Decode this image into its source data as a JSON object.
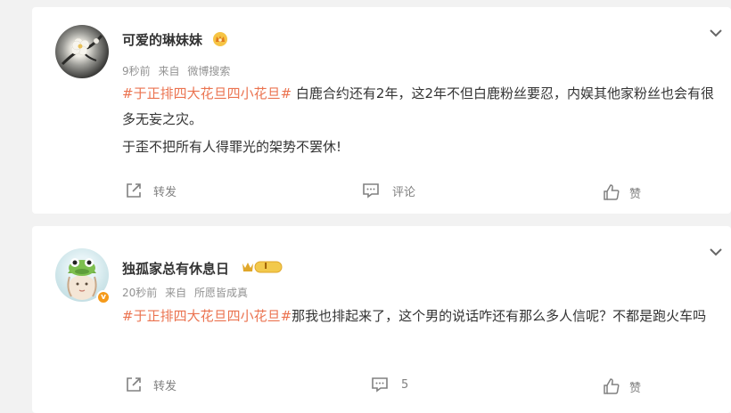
{
  "posts": [
    {
      "author": "可爱的琳妹妹",
      "time": "9秒前",
      "source_prefix": "来自",
      "source": "微博搜索",
      "topic": "#于正排四大花旦四小花旦#",
      "text_line1": " 白鹿合约还有2年，这2年不但白鹿粉丝要忍，内娱其他家粉丝也会有很多无妄之灾。",
      "text_line2": "于歪不把所有人得罪光的架势不罢休!",
      "repost_label": "转发",
      "comment_label": "评论",
      "like_label": "赞",
      "avatar_icon": "plum-blossom-avatar",
      "badge_icon": "crown-badge-icon"
    },
    {
      "author": "独孤家总有休息日",
      "time": "20秒前",
      "source_prefix": "来自",
      "source": "所愿皆成真",
      "topic": "#于正排四大花旦四小花旦#",
      "text_line1": "那我也排起来了，这个男的说话咋还有那么多人信呢？不都是跑火车吗",
      "repost_label": "转发",
      "comment_count": "5",
      "like_label": "赞",
      "avatar_icon": "frog-hat-avatar",
      "verify_mark": "v",
      "level_badge": "I",
      "level_badge_color": "#e0a72a"
    }
  ],
  "colors": {
    "topic": "#eb7350",
    "meta": "#939393",
    "action": "#808080",
    "background": "#f2f2f2"
  }
}
